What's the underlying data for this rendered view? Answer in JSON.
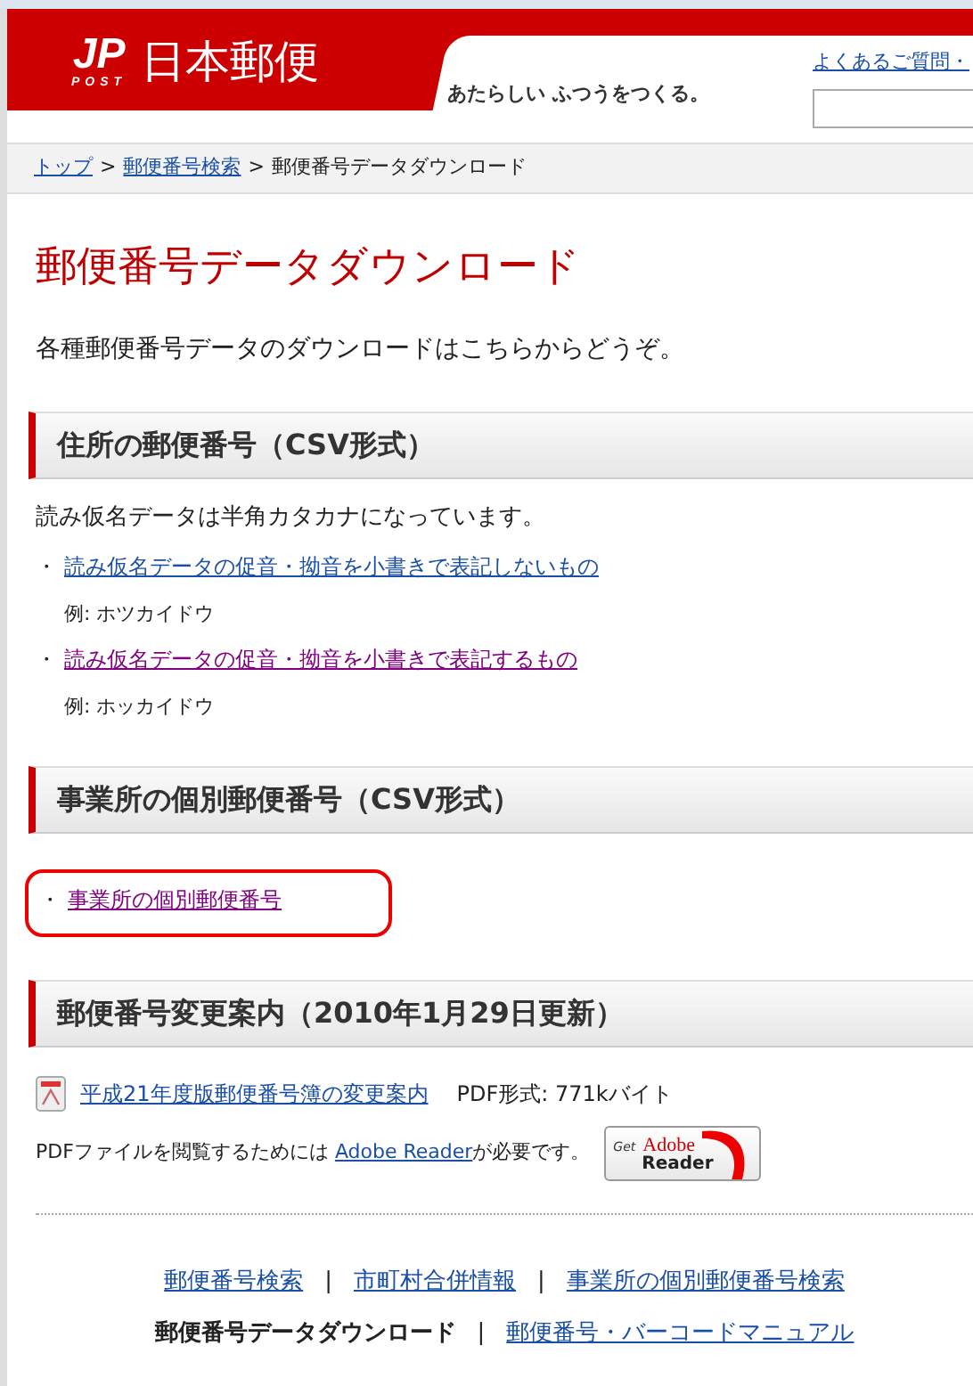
{
  "header": {
    "logo_mark": "JP",
    "logo_sub": "POST",
    "logo_name": "日本郵便",
    "tagline": "あたらしい ふつうをつくる。",
    "top_link": "よくあるご質問・"
  },
  "breadcrumb": [
    {
      "label": "トップ",
      "link": true
    },
    {
      "label": "郵便番号検索",
      "link": true
    },
    {
      "label": "郵便番号データダウンロード",
      "link": false
    }
  ],
  "breadcrumb_separator": ">",
  "title": "郵便番号データダウンロード",
  "intro": "各種郵便番号データのダウンロードはこちらからどうぞ。",
  "sections": [
    {
      "heading": "住所の郵便番号（CSV形式）",
      "note": "読み仮名データは半角カタカナになっています。",
      "items": [
        {
          "bullet": "・",
          "label": "読み仮名データの促音・拗音を小書きで表記しないもの",
          "visited": false,
          "highlighted": false,
          "example": "例: ホツカイドウ"
        },
        {
          "bullet": "・",
          "label": "読み仮名データの促音・拗音を小書きで表記するもの",
          "visited": true,
          "highlighted": false,
          "example": "例: ホッカイドウ"
        }
      ]
    },
    {
      "heading": "事業所の個別郵便番号（CSV形式）",
      "items": [
        {
          "bullet": "・",
          "label": "事業所の個別郵便番号",
          "visited": true,
          "highlighted": true
        }
      ]
    },
    {
      "heading": "郵便番号変更案内（2010年1月29日更新）",
      "pdf": {
        "label": "平成21年度版郵便番号簿の変更案内",
        "visited": false,
        "size": "PDF形式: 771kバイト"
      },
      "reader_note": {
        "before": "PDFファイルを閲覧するためには ",
        "link": "Adobe Reader",
        "after": "が必要です。"
      },
      "reader_badge": {
        "get": "Get",
        "brand": "Adobe",
        "product": "Reader"
      }
    }
  ],
  "footer_rows": [
    [
      {
        "label": "郵便番号検索",
        "current": false
      },
      {
        "label": "市町村合併情報",
        "current": false
      },
      {
        "label": "事業所の個別郵便番号検索",
        "current": false
      }
    ],
    [
      {
        "label": "郵便番号データダウンロード",
        "current": true
      },
      {
        "label": "郵便番号・バーコードマニュアル",
        "current": false
      }
    ]
  ],
  "footer_separator": "|"
}
